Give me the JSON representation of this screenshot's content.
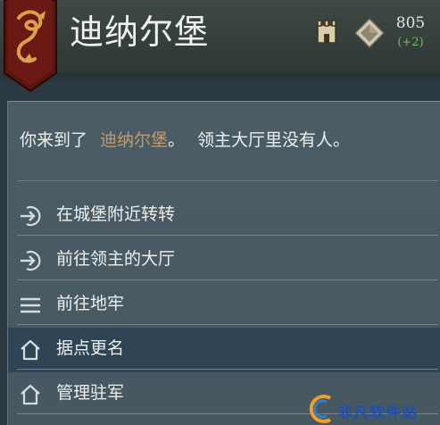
{
  "header": {
    "title": "迪纳尔堡",
    "gold_amount": "805",
    "gold_delta": "(+2)",
    "icons": [
      "castle-icon",
      "gold-diamond-icon"
    ],
    "banner_icon": "dragon-banner-icon"
  },
  "message": {
    "prefix": "你来到了",
    "place": "迪纳尔堡",
    "suffix": "。",
    "rest": "领主大厅里没有人。",
    "place_color": "#c69a6a"
  },
  "menu": {
    "items": [
      {
        "label": "在城堡附近转转",
        "icon": "arrow-enter-icon"
      },
      {
        "label": "前往领主的大厅",
        "icon": "arrow-enter-icon"
      },
      {
        "label": "前往地牢",
        "icon": "hamburger-lines-icon"
      },
      {
        "label": "据点更名",
        "icon": "house-outline-icon",
        "highlighted": true
      },
      {
        "label": "管理驻军",
        "icon": "house-outline-icon"
      }
    ]
  },
  "watermark": {
    "text": "非凡软件站"
  },
  "colors": {
    "header_bg": "#3a4442",
    "panel_bg": "#4a5b63",
    "highlight_bg": "#2f4455",
    "gold_delta": "#6fbf5a"
  }
}
